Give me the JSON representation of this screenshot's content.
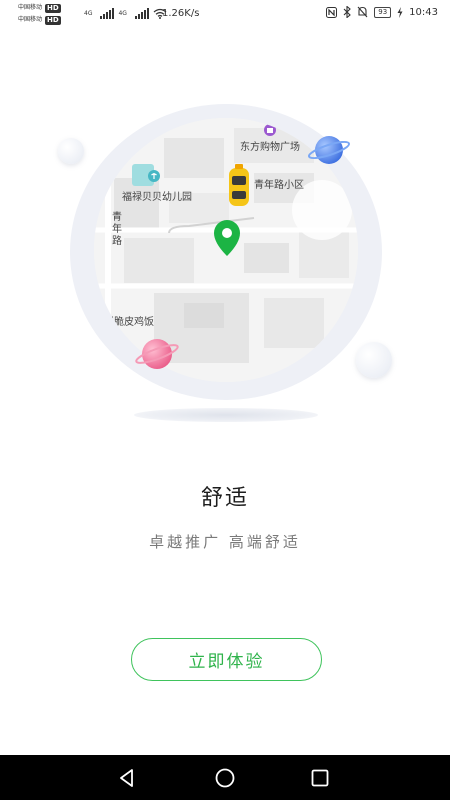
{
  "status_bar": {
    "carrier_1": "中国移动",
    "carrier_2": "中国移动",
    "hd_1": "HD",
    "hd_2": "HD",
    "net_1": "4G",
    "net_2": "4G",
    "speed": "1.26K/s",
    "battery": "93",
    "time": "10:43"
  },
  "map": {
    "poi_mall": "东方购物广场",
    "poi_kindergarten": "福禄贝贝幼儿园",
    "poi_community": "青年路小区",
    "poi_restaurant": "锅脆皮鸡饭",
    "road_name": "青年路"
  },
  "onboarding": {
    "title": "舒适",
    "subtitle": "卓越推广 高端舒适",
    "cta_label": "立即体验"
  },
  "nav_bar": {
    "back_icon": "back-triangle-icon",
    "home_icon": "home-circle-icon",
    "recents_icon": "recents-square-icon"
  },
  "colors": {
    "accent_green": "#2fb34b",
    "pin_green": "#1cb444",
    "car_yellow": "#f5c518",
    "planet_blue": "#5d8ff0",
    "planet_pink": "#f07aa0"
  }
}
